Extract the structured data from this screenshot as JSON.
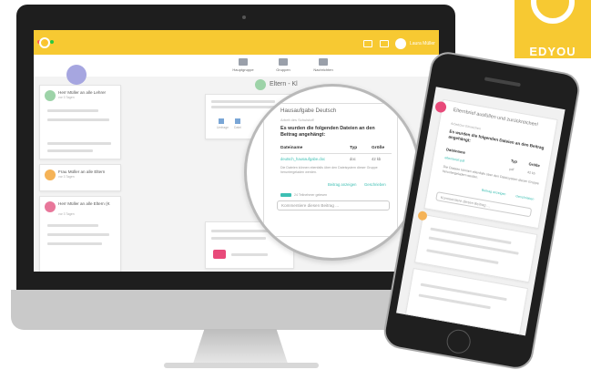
{
  "brand": {
    "name": "EDYOU",
    "accent": "#f7c932",
    "teal": "#3dbfb3",
    "pink": "#e84a7a"
  },
  "desktop": {
    "topbar": {
      "user_name": "Laura Müller",
      "icons": [
        "flag-icon",
        "mail-icon"
      ]
    },
    "nav": [
      {
        "label": "Hauptgruppe"
      },
      {
        "label": "Gruppen"
      },
      {
        "label": "Nachrichten"
      }
    ],
    "page_title": "Eltern - Kl",
    "sidebar_cards": [
      {
        "title": "Herr Müller an alle Lehrer",
        "sub": "vor 3 Tagen",
        "color": "#9dd3a8"
      },
      {
        "title": "Frau Müller an alle Eltern",
        "sub": "vor 3 Tagen",
        "color": "#f5b357"
      },
      {
        "title": "Herr Müller an alle Eltern (K",
        "sub": "vor 3 Tagen",
        "color": "#e8779a"
      }
    ],
    "post_actions": [
      "Umfrage",
      "Datei"
    ]
  },
  "magnifier": {
    "card_title": "Hausaufgabe Deutsch",
    "card_sub": "Arbeit des Schulstoff",
    "body": "Es wurden die folgenden Dateien an den Beitrag angehängt:",
    "table": {
      "headers": [
        "Dateiname",
        "Typ",
        "Größe"
      ],
      "rows": [
        [
          "deutsch_hausaufgabe.doc",
          "doc",
          "42 kb"
        ]
      ]
    },
    "note": "Die Dateien können ebenfalls über den Dateisystem dieser Gruppe heruntergeladen werden.",
    "actions": [
      "Beitrag anzeigen",
      "Geschrieben"
    ],
    "tag_text": "24 Teilnehmer gelesen",
    "comment_placeholder": "Kommentiere diesen Beitrag ..."
  },
  "phone": {
    "card_title": "Elternbrief ausfüllen und zurückreichen!",
    "card_sub": "Arbeit/zur Einreichen",
    "body": "Es wurden die folgenden Dateien an den Beitrag angehängt:",
    "table": {
      "headers": [
        "Dateiname",
        "Typ",
        "Größe"
      ],
      "rows": [
        [
          "elternbrief.pdf",
          "pdf",
          "42 kb"
        ]
      ]
    },
    "note": "Die Dateien können ebenfalls über den Dateisystem dieser Gruppe heruntergeladen werden.",
    "actions": [
      "Beitrag anzeigen",
      "Geschrieben"
    ],
    "comment_placeholder": "Kommentiere diesen Beitrag ..."
  }
}
